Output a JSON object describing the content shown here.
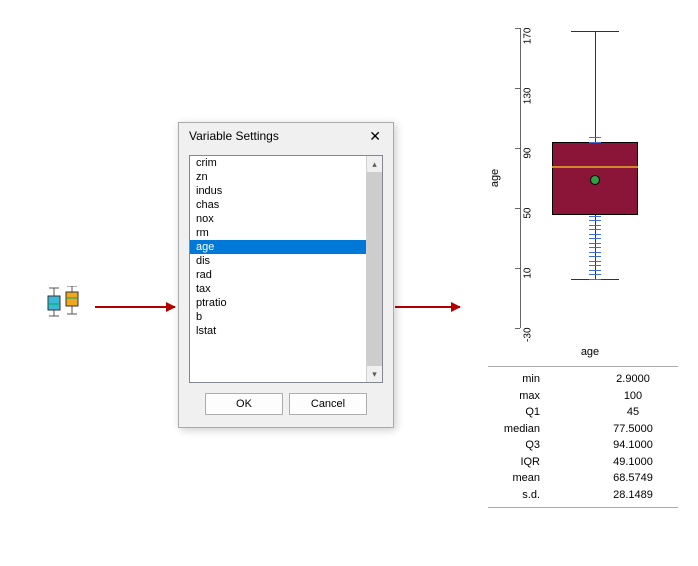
{
  "dialog": {
    "title": "Variable Settings",
    "items": [
      "crim",
      "zn",
      "indus",
      "chas",
      "nox",
      "rm",
      "age",
      "dis",
      "rad",
      "tax",
      "ptratio",
      "b",
      "lstat"
    ],
    "selected_index": 6,
    "ok_label": "OK",
    "cancel_label": "Cancel"
  },
  "chart_data": {
    "type": "boxplot",
    "ylabel": "age",
    "xlabel": "age",
    "ylim": [
      -30,
      170
    ],
    "yticks": [
      -30,
      10,
      50,
      90,
      130,
      170
    ],
    "min": 2.9,
    "q1": 45,
    "median": 77.5,
    "q3": 94.1,
    "max": 168,
    "mean": 68.5749
  },
  "stats": {
    "rows": [
      {
        "k": "min",
        "v": "2.9000"
      },
      {
        "k": "max",
        "v": "100"
      },
      {
        "k": "Q1",
        "v": "45"
      },
      {
        "k": "median",
        "v": "77.5000"
      },
      {
        "k": "Q3",
        "v": "94.1000"
      },
      {
        "k": "IQR",
        "v": "49.1000"
      },
      {
        "k": "mean",
        "v": "68.5749"
      },
      {
        "k": "s.d.",
        "v": "28.1489"
      }
    ]
  }
}
